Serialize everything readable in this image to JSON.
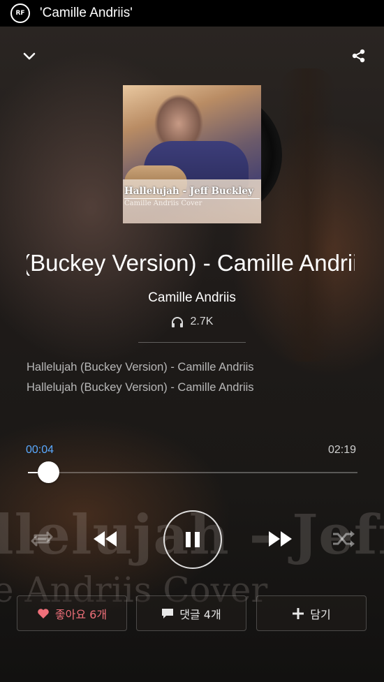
{
  "topbar": {
    "logo_text": "RF",
    "title": "'Camille Andriis'"
  },
  "cover": {
    "title": "Hallelujah - Jeff Buckley",
    "subtitle": "Camille Andriis Cover"
  },
  "track": {
    "title": "Hallelujah (Buckey Version) - Camille Andriis",
    "artist": "Camille Andriis",
    "plays": "2.7K",
    "description": [
      "Hallelujah (Buckey Version) - Camille Andriis",
      "Hallelujah (Buckey Version) - Camille Andriis"
    ]
  },
  "player": {
    "current_time": "00:04",
    "total_time": "02:19",
    "progress_fraction": 0.03
  },
  "background_text": {
    "line1": "llelujah - Jeff Buckley",
    "line2": "e Andriis Cover"
  },
  "actions": {
    "like_label": "좋아요 6개",
    "comment_label": "댓글 4개",
    "add_label": "담기"
  },
  "colors": {
    "accent": "#5aa9ff",
    "like": "#f0707a"
  },
  "icons": [
    "chevron-down-icon",
    "share-icon",
    "headphones-icon",
    "repeat-icon",
    "rewind-icon",
    "pause-icon",
    "fast-forward-icon",
    "shuffle-icon",
    "heart-icon",
    "comment-icon",
    "plus-icon"
  ]
}
